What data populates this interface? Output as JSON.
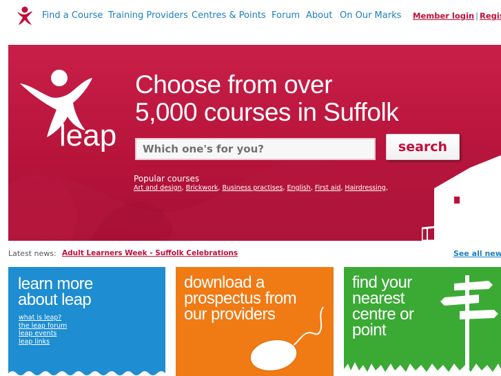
{
  "nav": {
    "items": [
      {
        "label": "Find a Course"
      },
      {
        "label": "Training Providers"
      },
      {
        "label": "Centres & Points"
      },
      {
        "label": "Forum"
      },
      {
        "label": "About"
      },
      {
        "label": "On Our Marks"
      }
    ],
    "member_login": "Member login",
    "separator": "|",
    "register": "Register"
  },
  "hero": {
    "logo_text": "leap",
    "headline_line1": "Choose from over",
    "headline_line2": "5,000 courses in Suffolk",
    "search_placeholder": "Which one's for you?",
    "search_button": "search",
    "popular_title": "Popular courses",
    "popular_links": [
      "Art and design",
      "Brickwork",
      "Business practises",
      "English",
      "First aid",
      "Hairdressing"
    ]
  },
  "news": {
    "label": "Latest news:",
    "item": "Adult Learners Week - Suffolk Celebrations",
    "see_all": "See all news"
  },
  "panels": {
    "learn": {
      "title_line1": "learn more",
      "title_line2": "about leap",
      "links": [
        "what is leap?",
        "the leap forum",
        "leap events",
        "leap links"
      ]
    },
    "download": {
      "title_line1": "download a",
      "title_line2": "prospectus from",
      "title_line3": "our providers"
    },
    "find": {
      "title_line1": "find your",
      "title_line2": "nearest",
      "title_line3": "centre or",
      "title_line4": "point"
    }
  },
  "colors": {
    "brand_red": "#c20d3a",
    "link_blue": "#1a7fbf",
    "panel_blue": "#1e8dd1",
    "panel_orange": "#f07a14",
    "panel_green": "#3aaa35"
  },
  "icons": [
    "leap-figure-icon",
    "search-icon",
    "mouse-icon",
    "signpost-icon",
    "house-icon"
  ]
}
